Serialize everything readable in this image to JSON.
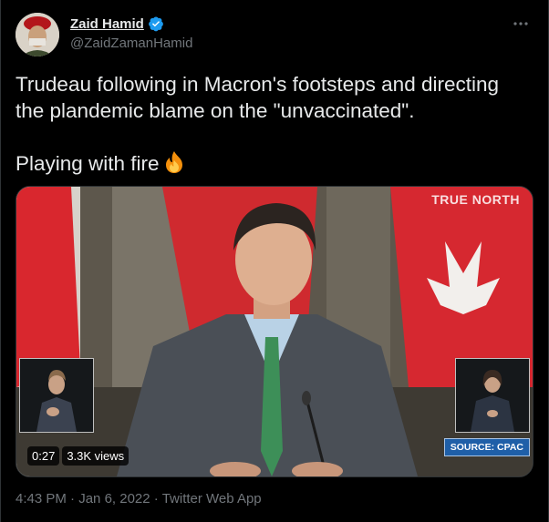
{
  "author": {
    "name": "Zaid Hamid",
    "handle": "@ZaidZamanHamid",
    "verified": true,
    "avatar_icon": "avatar"
  },
  "more_icon": "more-horizontal-icon",
  "tweet": {
    "line1": "Trudeau following in Macron's footsteps and directing",
    "line2": "the plandemic blame on the \"unvaccinated\".",
    "line3": "Playing with fire",
    "emoji": "fire-emoji"
  },
  "media": {
    "watermark": "TRUE NORTH",
    "source_badge": "SOURCE: CPAC",
    "duration": "0:27",
    "views": "3.3K views"
  },
  "footer": {
    "time": "4:43 PM",
    "separator": " · ",
    "date": "Jan 6, 2022",
    "separator2": " · ",
    "client": "Twitter Web App"
  },
  "colors": {
    "background": "#000000",
    "text": "#e7e9ea",
    "secondary": "#71767b",
    "verified": "#1d9bf0",
    "badge": "#1f5fa8"
  }
}
